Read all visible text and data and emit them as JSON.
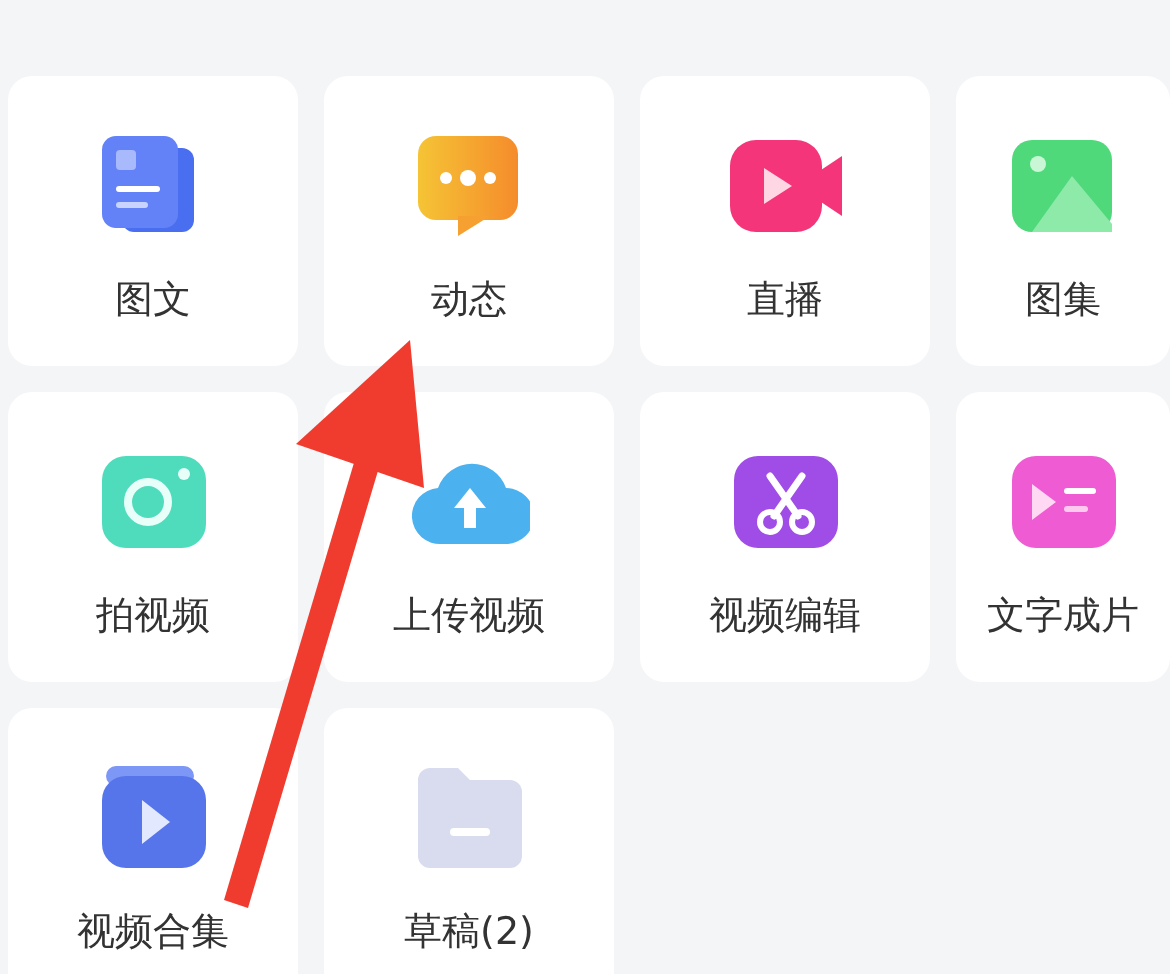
{
  "tiles": [
    {
      "label": "图文"
    },
    {
      "label": "动态"
    },
    {
      "label": "直播"
    },
    {
      "label": "图集"
    },
    {
      "label": "拍视频"
    },
    {
      "label": "上传视频"
    },
    {
      "label": "视频编辑"
    },
    {
      "label": "文字成片"
    },
    {
      "label": "视频合集"
    },
    {
      "label": "草稿(2)"
    }
  ]
}
